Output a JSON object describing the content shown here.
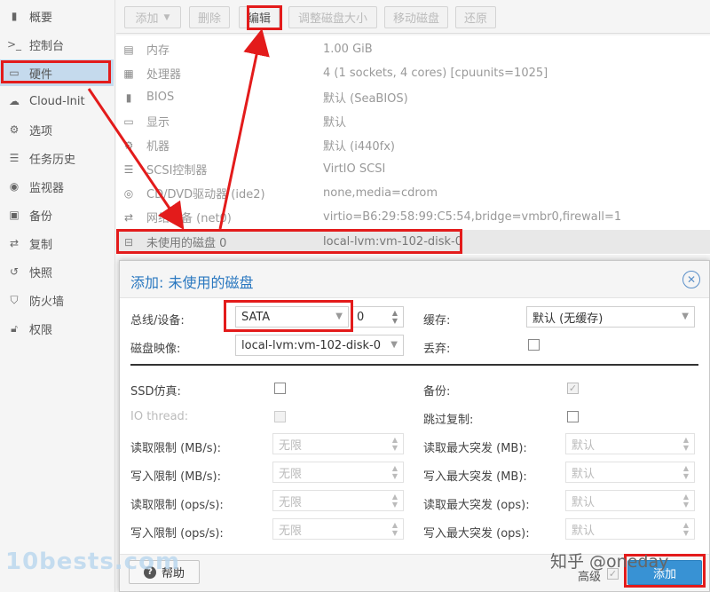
{
  "sidebar": {
    "items": [
      {
        "label": "概要",
        "icon": "book-icon"
      },
      {
        "label": "控制台",
        "icon": "terminal-icon"
      },
      {
        "label": "硬件",
        "icon": "monitor-icon",
        "active": true
      },
      {
        "label": "Cloud-Init",
        "icon": "cloud-icon"
      },
      {
        "label": "选项",
        "icon": "gear-icon"
      },
      {
        "label": "任务历史",
        "icon": "list-icon"
      },
      {
        "label": "监视器",
        "icon": "eye-icon"
      },
      {
        "label": "备份",
        "icon": "floppy-icon"
      },
      {
        "label": "复制",
        "icon": "retweet-icon"
      },
      {
        "label": "快照",
        "icon": "history-icon"
      },
      {
        "label": "防火墙",
        "icon": "shield-icon"
      },
      {
        "label": "权限",
        "icon": "unlock-icon"
      }
    ]
  },
  "toolbar": {
    "add": "添加",
    "remove": "删除",
    "edit": "编辑",
    "resize": "调整磁盘大小",
    "move": "移动磁盘",
    "revert": "还原"
  },
  "hardware": [
    {
      "icon": "memory-icon",
      "name": "内存",
      "value": "1.00 GiB"
    },
    {
      "icon": "cpu-icon",
      "name": "处理器",
      "value": "4 (1 sockets, 4 cores) [cpuunits=1025]"
    },
    {
      "icon": "chip-icon",
      "name": "BIOS",
      "value": "默认 (SeaBIOS)"
    },
    {
      "icon": "desktop-icon",
      "name": "显示",
      "value": "默认"
    },
    {
      "icon": "cogs-icon",
      "name": "机器",
      "value": "默认 (i440fx)"
    },
    {
      "icon": "database-icon",
      "name": "SCSI控制器",
      "value": "VirtIO SCSI"
    },
    {
      "icon": "cdrom-icon",
      "name": "CD/DVD驱动器 (ide2)",
      "value": "none,media=cdrom"
    },
    {
      "icon": "exchange-icon",
      "name": "网络设备 (net0)",
      "value": "virtio=B6:29:58:99:C5:54,bridge=vmbr0,firewall=1"
    },
    {
      "icon": "hdd-icon",
      "name": "未使用的磁盘 0",
      "value": "local-lvm:vm-102-disk-0",
      "selected": true
    }
  ],
  "dialog": {
    "title": "添加: 未使用的磁盘",
    "bus_label": "总线/设备:",
    "bus_value": "SATA",
    "device_value": "0",
    "image_label": "磁盘映像:",
    "image_value": "local-lvm:vm-102-disk-0",
    "cache_label": "缓存:",
    "cache_value": "默认 (无缓存)",
    "discard_label": "丢弃:",
    "ssd_label": "SSD仿真:",
    "iothread_label": "IO thread:",
    "backup_label": "备份:",
    "skip_repl_label": "跳过复制:",
    "read_limit_mb_label": "读取限制 (MB/s):",
    "write_limit_mb_label": "写入限制 (MB/s):",
    "read_limit_ops_label": "读取限制 (ops/s):",
    "write_limit_ops_label": "写入限制 (ops/s):",
    "read_burst_mb_label": "读取最大突发 (MB):",
    "write_burst_mb_label": "写入最大突发 (MB):",
    "read_burst_ops_label": "读取最大突发 (ops):",
    "write_burst_ops_label": "写入最大突发 (ops):",
    "unlimited": "无限",
    "default": "默认",
    "help": "帮助",
    "advanced": "高级",
    "add": "添加"
  },
  "watermark": {
    "left": "10bests.com",
    "right": "知乎 @oneday"
  },
  "colors": {
    "annotation_red": "#e31b1b",
    "accent_blue": "#3892d4",
    "title_blue": "#2a78c0",
    "selected_sidebar": "#c5daed"
  }
}
